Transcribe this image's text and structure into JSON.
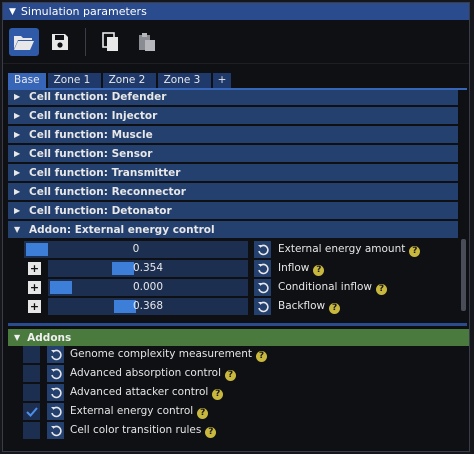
{
  "window": {
    "title": "Simulation parameters"
  },
  "toolbar": {
    "open": "folder-open-icon",
    "save": "save-icon",
    "copy": "copy-icon",
    "paste": "paste-icon"
  },
  "tabs": [
    "Base",
    "Zone 1",
    "Zone 2",
    "Zone 3",
    "+"
  ],
  "sections": [
    "Cell function: Defender",
    "Cell function: Injector",
    "Cell function: Muscle",
    "Cell function: Sensor",
    "Cell function: Transmitter",
    "Cell function: Reconnector",
    "Cell function: Detonator"
  ],
  "external_energy": {
    "title": "Addon: External energy control",
    "params": [
      {
        "label": "External energy amount",
        "value": "0",
        "fraction": 0.0
      },
      {
        "label": "Inflow",
        "value": "0.354",
        "fraction": 0.354
      },
      {
        "label": "Conditional inflow",
        "value": "0.000",
        "fraction": 0.0
      },
      {
        "label": "Backflow",
        "value": "0.368",
        "fraction": 0.368
      }
    ]
  },
  "addons": {
    "title": "Addons",
    "items": [
      {
        "label": "Genome complexity measurement",
        "checked": false
      },
      {
        "label": "Advanced absorption control",
        "checked": false
      },
      {
        "label": "Advanced attacker control",
        "checked": false
      },
      {
        "label": "External energy control",
        "checked": true
      },
      {
        "label": "Cell color transition rules",
        "checked": false
      }
    ]
  },
  "help_glyph": "?",
  "plus_glyph": "+",
  "colors": {
    "title_bar": "#2a4b8d",
    "header": "#24406f",
    "slider_grab": "#3c7ed8",
    "addons_header": "#4a7a3e",
    "help": "#c9b83e"
  }
}
